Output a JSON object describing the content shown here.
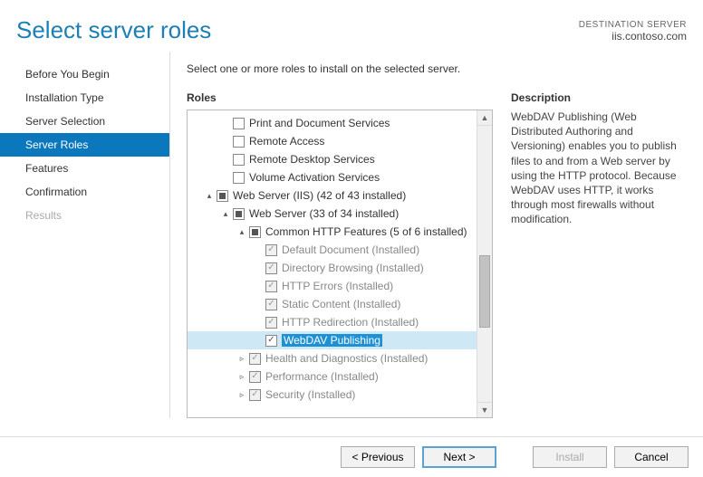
{
  "header": {
    "title": "Select server roles",
    "destination_label": "DESTINATION SERVER",
    "destination_host": "iis.contoso.com"
  },
  "sidebar": {
    "steps": [
      {
        "label": "Before You Begin",
        "state": "normal"
      },
      {
        "label": "Installation Type",
        "state": "normal"
      },
      {
        "label": "Server Selection",
        "state": "normal"
      },
      {
        "label": "Server Roles",
        "state": "active"
      },
      {
        "label": "Features",
        "state": "normal"
      },
      {
        "label": "Confirmation",
        "state": "normal"
      },
      {
        "label": "Results",
        "state": "disabled"
      }
    ]
  },
  "main": {
    "instruction": "Select one or more roles to install on the selected server.",
    "roles_heading": "Roles",
    "description_heading": "Description",
    "description_text": "WebDAV Publishing (Web Distributed Authoring and Versioning) enables you to publish files to and from a Web server by using the HTTP protocol. Because WebDAV uses HTTP, it works through most firewalls without modification."
  },
  "tree": [
    {
      "indent": 2,
      "exp": "",
      "chk": "unchecked",
      "label": "Print and Document Services"
    },
    {
      "indent": 2,
      "exp": "",
      "chk": "unchecked",
      "label": "Remote Access"
    },
    {
      "indent": 2,
      "exp": "",
      "chk": "unchecked",
      "label": "Remote Desktop Services"
    },
    {
      "indent": 2,
      "exp": "",
      "chk": "unchecked",
      "label": "Volume Activation Services"
    },
    {
      "indent": 1,
      "exp": "▴",
      "chk": "indet",
      "label": "Web Server (IIS) (42 of 43 installed)"
    },
    {
      "indent": 2,
      "exp": "▴",
      "chk": "indet",
      "label": "Web Server (33 of 34 installed)"
    },
    {
      "indent": 3,
      "exp": "▴",
      "chk": "indet",
      "label": "Common HTTP Features (5 of 6 installed)"
    },
    {
      "indent": 4,
      "exp": "",
      "chk": "checkedgray",
      "label": "Default Document (Installed)",
      "gray": true
    },
    {
      "indent": 4,
      "exp": "",
      "chk": "checkedgray",
      "label": "Directory Browsing (Installed)",
      "gray": true
    },
    {
      "indent": 4,
      "exp": "",
      "chk": "checkedgray",
      "label": "HTTP Errors (Installed)",
      "gray": true
    },
    {
      "indent": 4,
      "exp": "",
      "chk": "checkedgray",
      "label": "Static Content (Installed)",
      "gray": true
    },
    {
      "indent": 4,
      "exp": "",
      "chk": "checkedgray",
      "label": "HTTP Redirection (Installed)",
      "gray": true
    },
    {
      "indent": 4,
      "exp": "",
      "chk": "checked",
      "label": "WebDAV Publishing",
      "selected": true
    },
    {
      "indent": 3,
      "exp": "▹",
      "chk": "checkedgray",
      "label": "Health and Diagnostics (Installed)",
      "gray": true
    },
    {
      "indent": 3,
      "exp": "▹",
      "chk": "checkedgray",
      "label": "Performance (Installed)",
      "gray": true
    },
    {
      "indent": 3,
      "exp": "▹",
      "chk": "checkedgray",
      "label": "Security (Installed)",
      "gray": true
    }
  ],
  "footer": {
    "previous": "< Previous",
    "next": "Next >",
    "install": "Install",
    "cancel": "Cancel"
  }
}
